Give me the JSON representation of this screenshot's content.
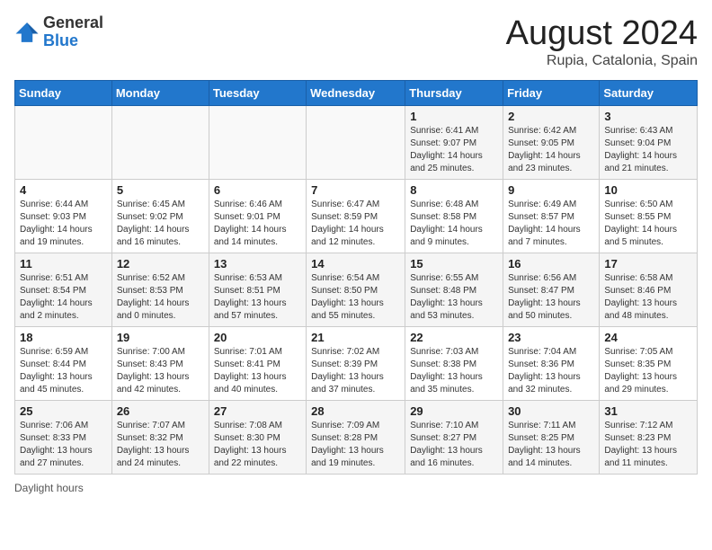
{
  "header": {
    "logo_general": "General",
    "logo_blue": "Blue",
    "title": "August 2024",
    "subtitle": "Rupia, Catalonia, Spain"
  },
  "days_of_week": [
    "Sunday",
    "Monday",
    "Tuesday",
    "Wednesday",
    "Thursday",
    "Friday",
    "Saturday"
  ],
  "weeks": [
    [
      {
        "day": "",
        "info": ""
      },
      {
        "day": "",
        "info": ""
      },
      {
        "day": "",
        "info": ""
      },
      {
        "day": "",
        "info": ""
      },
      {
        "day": "1",
        "info": "Sunrise: 6:41 AM\nSunset: 9:07 PM\nDaylight: 14 hours and 25 minutes."
      },
      {
        "day": "2",
        "info": "Sunrise: 6:42 AM\nSunset: 9:05 PM\nDaylight: 14 hours and 23 minutes."
      },
      {
        "day": "3",
        "info": "Sunrise: 6:43 AM\nSunset: 9:04 PM\nDaylight: 14 hours and 21 minutes."
      }
    ],
    [
      {
        "day": "4",
        "info": "Sunrise: 6:44 AM\nSunset: 9:03 PM\nDaylight: 14 hours and 19 minutes."
      },
      {
        "day": "5",
        "info": "Sunrise: 6:45 AM\nSunset: 9:02 PM\nDaylight: 14 hours and 16 minutes."
      },
      {
        "day": "6",
        "info": "Sunrise: 6:46 AM\nSunset: 9:01 PM\nDaylight: 14 hours and 14 minutes."
      },
      {
        "day": "7",
        "info": "Sunrise: 6:47 AM\nSunset: 8:59 PM\nDaylight: 14 hours and 12 minutes."
      },
      {
        "day": "8",
        "info": "Sunrise: 6:48 AM\nSunset: 8:58 PM\nDaylight: 14 hours and 9 minutes."
      },
      {
        "day": "9",
        "info": "Sunrise: 6:49 AM\nSunset: 8:57 PM\nDaylight: 14 hours and 7 minutes."
      },
      {
        "day": "10",
        "info": "Sunrise: 6:50 AM\nSunset: 8:55 PM\nDaylight: 14 hours and 5 minutes."
      }
    ],
    [
      {
        "day": "11",
        "info": "Sunrise: 6:51 AM\nSunset: 8:54 PM\nDaylight: 14 hours and 2 minutes."
      },
      {
        "day": "12",
        "info": "Sunrise: 6:52 AM\nSunset: 8:53 PM\nDaylight: 14 hours and 0 minutes."
      },
      {
        "day": "13",
        "info": "Sunrise: 6:53 AM\nSunset: 8:51 PM\nDaylight: 13 hours and 57 minutes."
      },
      {
        "day": "14",
        "info": "Sunrise: 6:54 AM\nSunset: 8:50 PM\nDaylight: 13 hours and 55 minutes."
      },
      {
        "day": "15",
        "info": "Sunrise: 6:55 AM\nSunset: 8:48 PM\nDaylight: 13 hours and 53 minutes."
      },
      {
        "day": "16",
        "info": "Sunrise: 6:56 AM\nSunset: 8:47 PM\nDaylight: 13 hours and 50 minutes."
      },
      {
        "day": "17",
        "info": "Sunrise: 6:58 AM\nSunset: 8:46 PM\nDaylight: 13 hours and 48 minutes."
      }
    ],
    [
      {
        "day": "18",
        "info": "Sunrise: 6:59 AM\nSunset: 8:44 PM\nDaylight: 13 hours and 45 minutes."
      },
      {
        "day": "19",
        "info": "Sunrise: 7:00 AM\nSunset: 8:43 PM\nDaylight: 13 hours and 42 minutes."
      },
      {
        "day": "20",
        "info": "Sunrise: 7:01 AM\nSunset: 8:41 PM\nDaylight: 13 hours and 40 minutes."
      },
      {
        "day": "21",
        "info": "Sunrise: 7:02 AM\nSunset: 8:39 PM\nDaylight: 13 hours and 37 minutes."
      },
      {
        "day": "22",
        "info": "Sunrise: 7:03 AM\nSunset: 8:38 PM\nDaylight: 13 hours and 35 minutes."
      },
      {
        "day": "23",
        "info": "Sunrise: 7:04 AM\nSunset: 8:36 PM\nDaylight: 13 hours and 32 minutes."
      },
      {
        "day": "24",
        "info": "Sunrise: 7:05 AM\nSunset: 8:35 PM\nDaylight: 13 hours and 29 minutes."
      }
    ],
    [
      {
        "day": "25",
        "info": "Sunrise: 7:06 AM\nSunset: 8:33 PM\nDaylight: 13 hours and 27 minutes."
      },
      {
        "day": "26",
        "info": "Sunrise: 7:07 AM\nSunset: 8:32 PM\nDaylight: 13 hours and 24 minutes."
      },
      {
        "day": "27",
        "info": "Sunrise: 7:08 AM\nSunset: 8:30 PM\nDaylight: 13 hours and 22 minutes."
      },
      {
        "day": "28",
        "info": "Sunrise: 7:09 AM\nSunset: 8:28 PM\nDaylight: 13 hours and 19 minutes."
      },
      {
        "day": "29",
        "info": "Sunrise: 7:10 AM\nSunset: 8:27 PM\nDaylight: 13 hours and 16 minutes."
      },
      {
        "day": "30",
        "info": "Sunrise: 7:11 AM\nSunset: 8:25 PM\nDaylight: 13 hours and 14 minutes."
      },
      {
        "day": "31",
        "info": "Sunrise: 7:12 AM\nSunset: 8:23 PM\nDaylight: 13 hours and 11 minutes."
      }
    ]
  ],
  "footer": {
    "daylight_label": "Daylight hours"
  }
}
